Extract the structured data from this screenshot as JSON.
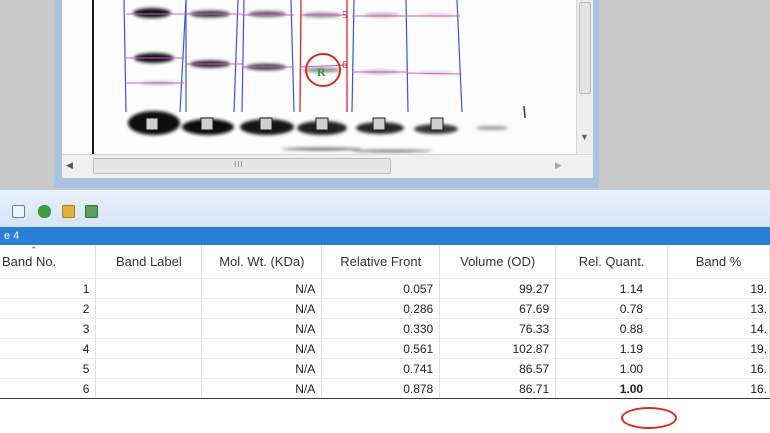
{
  "gel": {
    "band_labels": [
      "5",
      "6"
    ],
    "reference_label": "R"
  },
  "table": {
    "lane_title": "e 4",
    "columns": [
      "Band No.",
      "Band Label",
      "Mol. Wt. (KDa)",
      "Relative Front",
      "Volume (OD)",
      "Rel. Quant.",
      "Band %"
    ],
    "rows": [
      {
        "no": "1",
        "label": "",
        "mw": "N/A",
        "rf": "0.057",
        "vol": "99.27",
        "rq": "1.14",
        "pct": "19."
      },
      {
        "no": "2",
        "label": "",
        "mw": "N/A",
        "rf": "0.286",
        "vol": "67.69",
        "rq": "0.78",
        "pct": "13."
      },
      {
        "no": "3",
        "label": "",
        "mw": "N/A",
        "rf": "0.330",
        "vol": "76.33",
        "rq": "0.88",
        "pct": "14."
      },
      {
        "no": "4",
        "label": "",
        "mw": "N/A",
        "rf": "0.561",
        "vol": "102.87",
        "rq": "1.19",
        "pct": "19."
      },
      {
        "no": "5",
        "label": "",
        "mw": "N/A",
        "rf": "0.741",
        "vol": "86.57",
        "rq": "1.00",
        "pct": "16."
      },
      {
        "no": "6",
        "label": "",
        "mw": "N/A",
        "rf": "0.878",
        "vol": "86.71",
        "rq": "1.00",
        "pct": "16."
      }
    ]
  },
  "scroll": {
    "grip": "III"
  },
  "toolbar": {
    "icons": [
      "copy-icon",
      "database-icon",
      "open-folder-icon",
      "export-icon"
    ]
  },
  "colors": {
    "lane_header": "#2a7fd6",
    "lane_lines": "#3a55d8",
    "selected_lane": "#e0262a",
    "band_lines": "#d05ad0",
    "highlight_circle": "#d42b1e"
  }
}
